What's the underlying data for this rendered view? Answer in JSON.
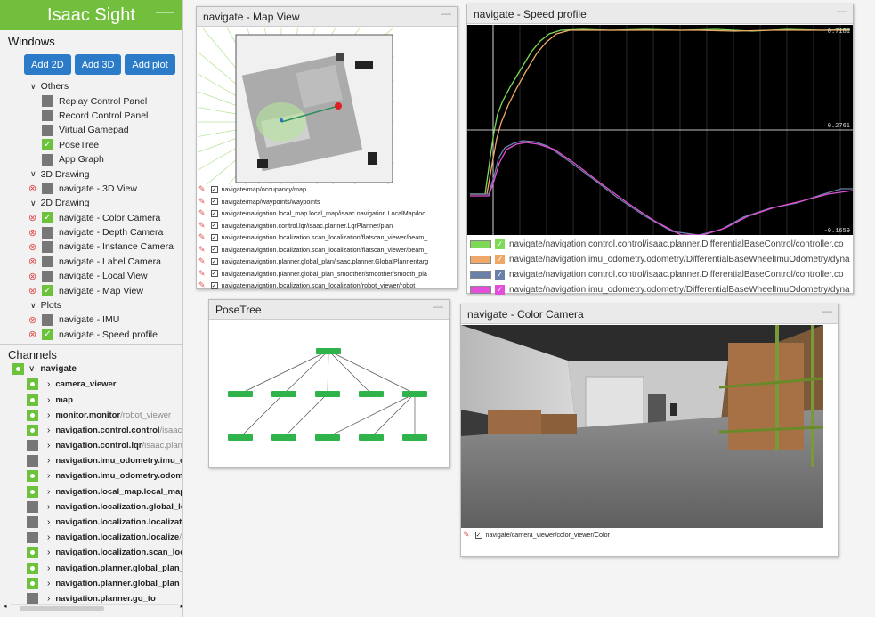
{
  "app": {
    "title": "Isaac Sight",
    "minimize": "—"
  },
  "windows_panel": {
    "title": "Windows",
    "buttons": [
      "Add 2D",
      "Add 3D",
      "Add plot"
    ],
    "groups": [
      {
        "label": "Others",
        "items": [
          {
            "label": "Replay Control Panel",
            "checked": false,
            "removable": false
          },
          {
            "label": "Record Control Panel",
            "checked": false,
            "removable": false
          },
          {
            "label": "Virtual Gamepad",
            "checked": false,
            "removable": false
          },
          {
            "label": "PoseTree",
            "checked": true,
            "removable": false
          },
          {
            "label": "App Graph",
            "checked": false,
            "removable": false
          }
        ]
      },
      {
        "label": "3D Drawing",
        "items": [
          {
            "label": "navigate - 3D View",
            "checked": false,
            "removable": true
          }
        ]
      },
      {
        "label": "2D Drawing",
        "items": [
          {
            "label": "navigate - Color Camera",
            "checked": true,
            "removable": true
          },
          {
            "label": "navigate - Depth Camera",
            "checked": false,
            "removable": true
          },
          {
            "label": "navigate - Instance Camera",
            "checked": false,
            "removable": true
          },
          {
            "label": "navigate - Label Camera",
            "checked": false,
            "removable": true
          },
          {
            "label": "navigate - Local View",
            "checked": false,
            "removable": true
          },
          {
            "label": "navigate - Map View",
            "checked": true,
            "removable": true
          }
        ]
      },
      {
        "label": "Plots",
        "items": [
          {
            "label": "navigate - IMU",
            "checked": false,
            "removable": true
          },
          {
            "label": "navigate - Speed profile",
            "checked": true,
            "removable": true
          }
        ]
      }
    ]
  },
  "channels_panel": {
    "title": "Channels",
    "root": {
      "label": "navigate",
      "on": true
    },
    "items": [
      {
        "bold": "camera_viewer",
        "rest": "",
        "on": true
      },
      {
        "bold": "map",
        "rest": "",
        "on": true
      },
      {
        "bold": "monitor.monitor",
        "rest": "/robot_viewer",
        "on": true
      },
      {
        "bold": "navigation.control.control",
        "rest": "/isaac.pla",
        "on": true
      },
      {
        "bold": "navigation.control.lqr",
        "rest": "/isaac.planner.",
        "on": false
      },
      {
        "bold": "navigation.imu_odometry.imu_corre",
        "rest": "",
        "on": false
      },
      {
        "bold": "navigation.imu_odometry.odometry.",
        "rest": "",
        "on": true
      },
      {
        "bold": "navigation.local_map.local_map",
        "rest": "",
        "on": true
      },
      {
        "bold": "navigation.localization.global_locali",
        "rest": "",
        "on": false
      },
      {
        "bold": "navigation.localization.localization_",
        "rest": "",
        "on": false
      },
      {
        "bold": "navigation.localization.localize",
        "rest": "/isaa",
        "on": false
      },
      {
        "bold": "navigation.localization.scan_localiz",
        "rest": "",
        "on": true
      },
      {
        "bold": "navigation.planner.global_plan_smo",
        "rest": "",
        "on": true
      },
      {
        "bold": "navigation.planner.global_plan",
        "rest": "",
        "on": true
      },
      {
        "bold": "navigation.planner.go_to",
        "rest": "",
        "on": false
      }
    ]
  },
  "map_view": {
    "title": "navigate - Map View",
    "layers": [
      "navigate/map/occupancy/map",
      "navigate/map/waypoints/waypoints",
      "navigate/navigation.local_map.local_map/isaac.navigation.LocalMap/loc",
      "navigate/navigation.control.lqr/isaac.planner.LqrPlanner/plan",
      "navigate/navigation.localization.scan_localization/flatscan_viewer/beam_",
      "navigate/navigation.localization.scan_localization/flatscan_viewer/beam_",
      "navigate/navigation.planner.global_plan/isaac.planner.GlobalPlanner/targ",
      "navigate/navigation.planner.global_plan_smoother/smoother/smooth_pla",
      "navigate/navigation.localization.scan_localization/robot_viewer/robot"
    ]
  },
  "speed_profile": {
    "title": "navigate - Speed profile",
    "labels": {
      "top": "0.7181",
      "mid": "0.2761",
      "bottom": "-0.1659"
    },
    "legend": [
      {
        "label": "navigate/navigation.control.control/isaac.planner.DifferentialBaseControl/controller.co",
        "color": "#7ed957"
      },
      {
        "label": "navigate/navigation.imu_odometry.odometry/DifferentialBaseWheelImuOdometry/dyna",
        "color": "#f0a868"
      },
      {
        "label": "navigate/navigation.control.control/isaac.planner.DifferentialBaseControl/controller.co",
        "color": "#6b80a8"
      },
      {
        "label": "navigate/navigation.imu_odometry.odometry/DifferentialBaseWheelImuOdometry/dyna",
        "color": "#e24fd8"
      }
    ]
  },
  "pose_tree": {
    "title": "PoseTree"
  },
  "color_camera": {
    "title": "navigate - Color Camera",
    "layers": [
      "navigate/camera_viewer/color_viewer/Color"
    ]
  },
  "colors": {
    "accent": "#72bf3d",
    "button": "#2b7bc8",
    "remove": "#e05252"
  }
}
